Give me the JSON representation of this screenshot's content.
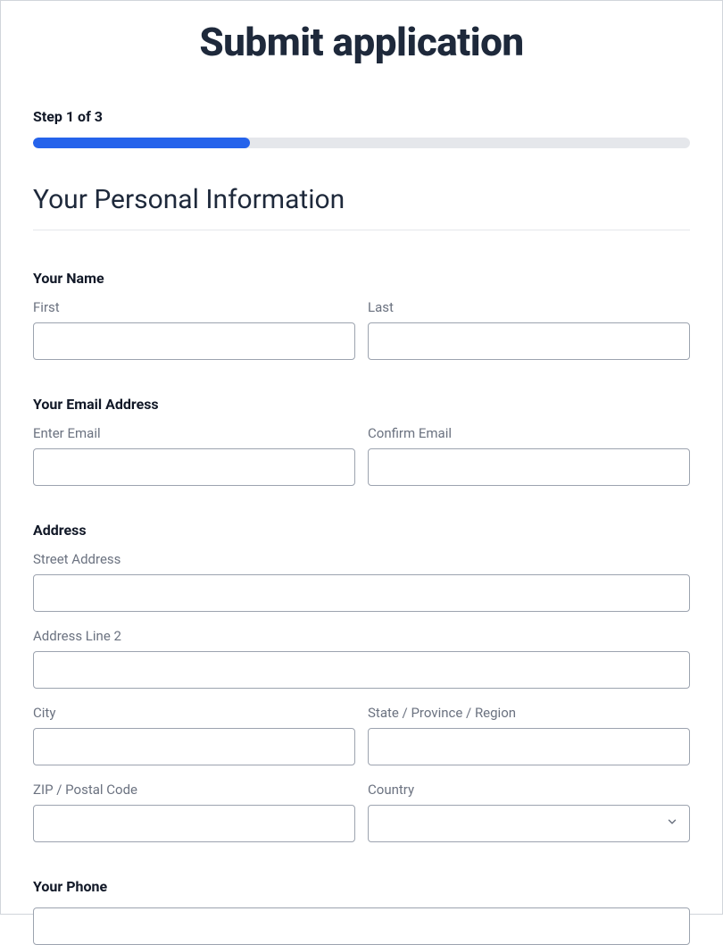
{
  "page": {
    "title": "Submit application"
  },
  "progress": {
    "step_label": "Step 1 of 3",
    "current": 1,
    "total": 3,
    "percent": 33
  },
  "section": {
    "heading": "Your Personal Information"
  },
  "name": {
    "group_label": "Your Name",
    "first": {
      "label": "First",
      "value": ""
    },
    "last": {
      "label": "Last",
      "value": ""
    }
  },
  "email": {
    "group_label": "Your Email Address",
    "enter": {
      "label": "Enter Email",
      "value": ""
    },
    "confirm": {
      "label": "Confirm Email",
      "value": ""
    }
  },
  "address": {
    "group_label": "Address",
    "street": {
      "label": "Street Address",
      "value": ""
    },
    "line2": {
      "label": "Address Line 2",
      "value": ""
    },
    "city": {
      "label": "City",
      "value": ""
    },
    "state": {
      "label": "State / Province / Region",
      "value": ""
    },
    "zip": {
      "label": "ZIP / Postal Code",
      "value": ""
    },
    "country": {
      "label": "Country",
      "value": ""
    }
  },
  "phone": {
    "group_label": "Your Phone",
    "value": ""
  }
}
